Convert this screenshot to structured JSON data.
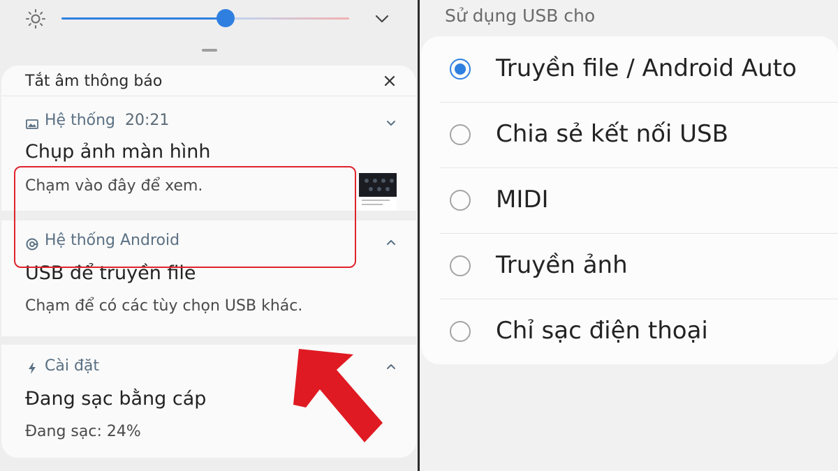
{
  "quick_panel": {
    "brightness_percent": 55,
    "mute_label": "Tắt âm thông báo"
  },
  "notifications": [
    {
      "app": "Hệ thống",
      "time": "20:21",
      "title": "Chụp ảnh màn hình",
      "body": "Chạm vào đây để xem.",
      "icon": "image-icon",
      "expanded": false
    },
    {
      "app": "Hệ thống Android",
      "time": "",
      "title": "USB để truyền file",
      "body": "Chạm để có các tùy chọn USB khác.",
      "icon": "android-system-icon",
      "expanded": true,
      "highlighted": true
    },
    {
      "app": "Cài đặt",
      "time": "",
      "title": "Đang sạc bằng cáp",
      "body": "Đang sạc: 24%",
      "icon": "bolt-icon",
      "expanded": true
    }
  ],
  "usb_dialog": {
    "title": "Sử dụng USB cho",
    "options": [
      {
        "label": "Truyền file / Android Auto",
        "selected": true
      },
      {
        "label": "Chia sẻ kết nối USB",
        "selected": false
      },
      {
        "label": "MIDI",
        "selected": false
      },
      {
        "label": "Truyền ảnh",
        "selected": false
      },
      {
        "label": "Chỉ sạc điện thoại",
        "selected": false
      }
    ]
  },
  "colors": {
    "accent": "#2f7fe0",
    "highlight_border": "#e0232b",
    "arrow": "#e01a22"
  }
}
